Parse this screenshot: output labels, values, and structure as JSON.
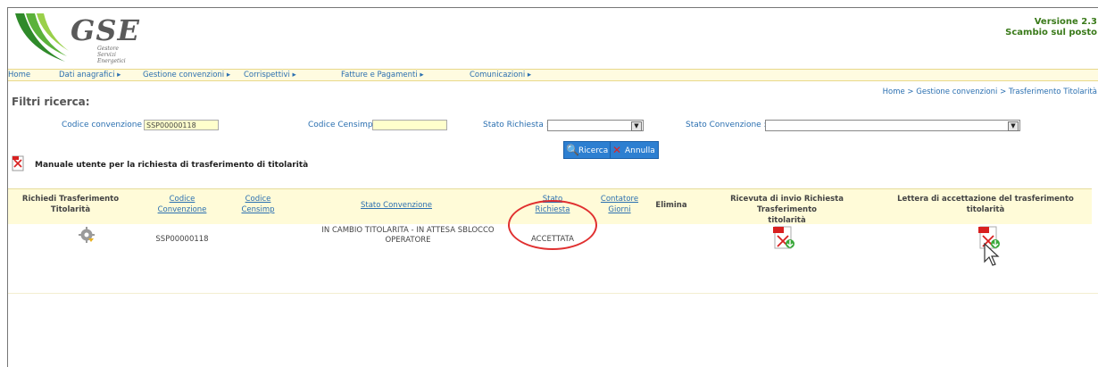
{
  "header": {
    "logo_text": "GSE",
    "logo_sub_1": "Gestore",
    "logo_sub_2": "Servizi",
    "logo_sub_3": "Energetici",
    "version": "Versione 2.3",
    "subtitle": "Scambio sul posto"
  },
  "menu": [
    {
      "label": "Home"
    },
    {
      "label": "Dati anagrafici ▸"
    },
    {
      "label": "Gestione convenzioni ▸"
    },
    {
      "label": "Corrispettivi ▸"
    },
    {
      "label": "Fatture e Pagamenti ▸"
    },
    {
      "label": "Comunicazioni ▸"
    }
  ],
  "breadcrumb": "Home > Gestione convenzioni > Trasferimento Titolarità",
  "filters": {
    "title": "Filtri ricerca:",
    "codice_convenzione_label": "Codice convenzione :",
    "codice_convenzione_value": "SSP00000118",
    "codice_censimp_label": "Codice Censimp :",
    "codice_censimp_value": "",
    "stato_richiesta_label": "Stato Richiesta :",
    "stato_convenzione_label": "Stato Convenzione :",
    "search_button": "Ricerca",
    "cancel_button": "Annulla"
  },
  "manual_link": "Manuale utente per la richiesta di trasferimento di titolarità",
  "table": {
    "headers": {
      "richiedi_1": "Richiedi Trasferimento",
      "richiedi_2": "Titolarità",
      "codice_conv_1": "Codice",
      "codice_conv_2": "Convenzione",
      "codice_cens_1": "Codice",
      "codice_cens_2": "Censimp",
      "stato_conv": "Stato Convenzione",
      "stato_rich_1": "Stato",
      "stato_rich_2": "Richiesta",
      "contatore_1": "Contatore",
      "contatore_2": "Giorni",
      "elimina": "Elimina",
      "ricevuta_1": "Ricevuta di invio Richiesta Trasferimento",
      "ricevuta_2": "titolarità",
      "lettera_1": "Lettera di accettazione del trasferimento",
      "lettera_2": "titolarità"
    },
    "rows": [
      {
        "codice_convenzione": "SSP00000118",
        "stato_convenzione_1": "IN CAMBIO TITOLARITA - IN ATTESA SBLOCCO",
        "stato_convenzione_2": "OPERATORE",
        "stato_richiesta": "ACCETTATA"
      }
    ]
  },
  "colors": {
    "accent": "#2a6fb0",
    "highlight_circle": "#e03030",
    "header_bg": "#fffbd8"
  }
}
